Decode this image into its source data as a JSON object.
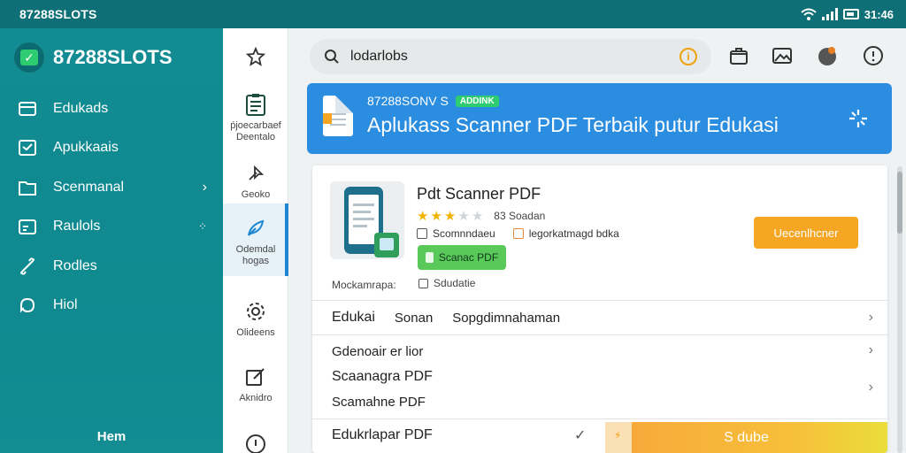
{
  "status_bar": {
    "app_name": "87288SLOTS",
    "time": "31:46"
  },
  "drawer": {
    "brand": "87288SLOTS",
    "items": [
      {
        "label": "Edukads",
        "icon": "card-icon",
        "trail": ""
      },
      {
        "label": "Apukkaais",
        "icon": "inbox-icon",
        "trail": ""
      },
      {
        "label": "Scenmanal",
        "icon": "folder-icon",
        "trail": "›"
      },
      {
        "label": "Raulols",
        "icon": "calendar-icon",
        "trail": "⁘"
      },
      {
        "label": "Rodles",
        "icon": "link-icon",
        "trail": ""
      },
      {
        "label": "Hiol",
        "icon": "puzzle-icon",
        "trail": ""
      }
    ],
    "footer": "Hem"
  },
  "rail": {
    "items": [
      {
        "label": "",
        "icon": "star-outline-icon"
      },
      {
        "label": "ṕjoecarbaef Deentalo",
        "icon": "clipboard-icon"
      },
      {
        "label": "Geoko",
        "icon": "pin-icon"
      },
      {
        "label": "Odemdal hogas",
        "icon": "leaf-icon",
        "active": true
      },
      {
        "label": "Olideens",
        "icon": "settings-icon"
      },
      {
        "label": "Aknidro",
        "icon": "edit-icon"
      },
      {
        "label": "",
        "icon": "info-icon"
      }
    ]
  },
  "search": {
    "query": "lodarlobs"
  },
  "banner": {
    "line1": "87288SONV S",
    "badge": "ADDINK",
    "title": "Aplukass Scanner PDF Terbaik putur Edukasi"
  },
  "app_card": {
    "title": "Pdt Scanner PDF",
    "rating": 2.5,
    "rating_count": "83 Soadan",
    "meta1": "Scomnndaeu",
    "meta2": "legorkatmagd bdka",
    "pill": "Scanac PDF",
    "note_left": "Mockamrapa:",
    "note_right": "Sdudatie",
    "cta": "Uecenlhcner"
  },
  "tabs": {
    "first": "Edukai",
    "second": "Sonan",
    "third": "Sopgdimnahaman"
  },
  "list": {
    "item1": "Gdenoair er lior",
    "item2": "Scaanagra PDF",
    "item3": "Scamahne PDF"
  },
  "bottom": {
    "label": "Edukrlapar PDF",
    "check": "✓",
    "promo": "S dube",
    "promo_icon": "⚡"
  },
  "colors": {
    "status_bar": "#0e6f77",
    "drawer": "#128b93",
    "banner": "#2b8de0",
    "cta": "#f5a623",
    "pill": "#59c95a",
    "star": "#f0b400"
  }
}
